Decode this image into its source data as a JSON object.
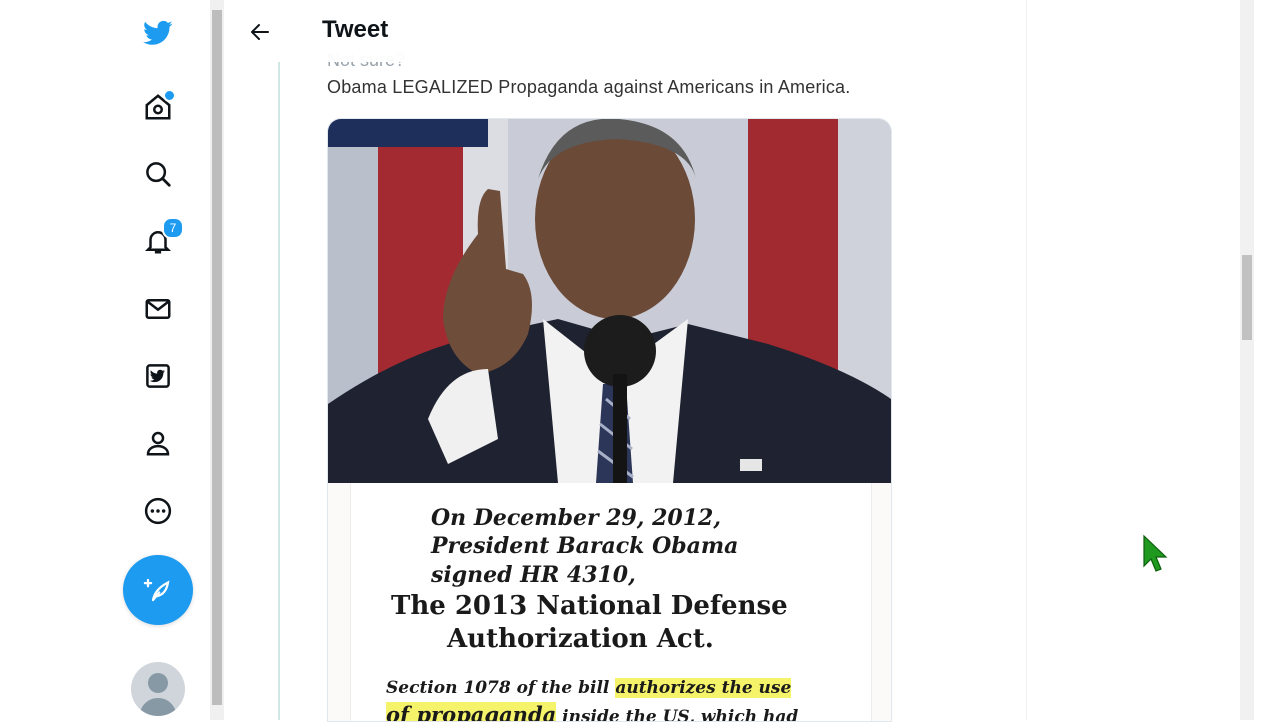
{
  "header": {
    "title": "Tweet"
  },
  "sidebar": {
    "notifications_count": "7"
  },
  "tweet": {
    "partial_text": "Not sure?",
    "text": "Obama LEGALIZED Propaganda against Americans in America."
  },
  "document": {
    "line1": "On December 29, 2012,",
    "line2": "President Barack Obama",
    "line3": "signed HR 4310,",
    "line4": "The 2013 National Defense",
    "line5": "Authorization Act.",
    "section_pre": "Section 1078 of the bill ",
    "section_hl": "authorizes the use",
    "line7_hl": "of propaganda",
    "line7_post": " inside the US, which had"
  },
  "colors": {
    "accent": "#1d9bf0",
    "highlight": "#f5f36a"
  },
  "icons": [
    "twitter-logo-icon",
    "home-icon",
    "search-icon",
    "bell-icon",
    "mail-icon",
    "bookmark-icon",
    "profile-icon",
    "more-icon",
    "compose-icon",
    "back-arrow-icon",
    "cursor-icon"
  ]
}
